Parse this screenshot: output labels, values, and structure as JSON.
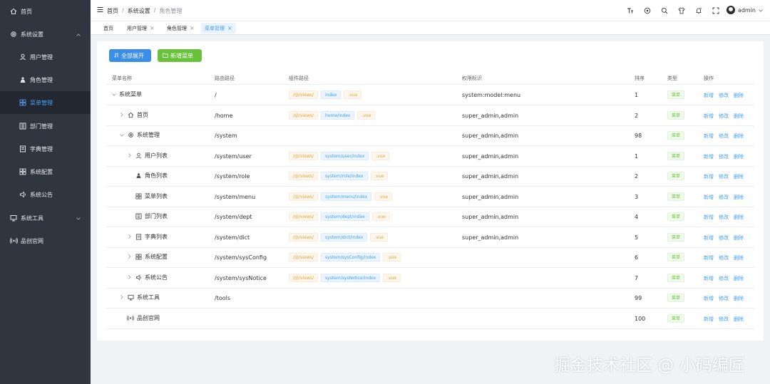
{
  "sidebar": {
    "items": [
      {
        "label": "首页",
        "icon": "home-icon"
      },
      {
        "label": "系统设置",
        "icon": "gear-icon"
      },
      {
        "label": "用户管理",
        "icon": "user-icon"
      },
      {
        "label": "角色管理",
        "icon": "role-icon"
      },
      {
        "label": "菜单管理",
        "icon": "menu-icon"
      },
      {
        "label": "部门管理",
        "icon": "dept-icon"
      },
      {
        "label": "字典管理",
        "icon": "dict-icon"
      },
      {
        "label": "系统配置",
        "icon": "config-icon"
      },
      {
        "label": "系统公告",
        "icon": "notice-icon"
      },
      {
        "label": "系统工具",
        "icon": "monitor-icon"
      },
      {
        "label": "品创官网",
        "icon": "broadcast-icon"
      }
    ]
  },
  "breadcrumb": {
    "home": "首页",
    "section": "系统设置",
    "current": "角色管理",
    "sep": "/"
  },
  "user": {
    "name": "admin"
  },
  "tabs": [
    {
      "label": "首页",
      "closable": false
    },
    {
      "label": "用户管理",
      "closable": true
    },
    {
      "label": "角色管理",
      "closable": true
    },
    {
      "label": "菜单管理",
      "closable": true
    }
  ],
  "toolbar": {
    "expand_label": "全部展开",
    "add_label": "新增菜单"
  },
  "table": {
    "headers": {
      "name": "菜单名称",
      "route": "路由路径",
      "component": "组件路径",
      "perm": "权限标识",
      "sort": "排序",
      "type": "类型",
      "ops": "操作"
    },
    "ops": {
      "add": "新增",
      "edit": "修改",
      "del": "删除"
    },
    "type_label": "菜单",
    "rows": [
      {
        "name": "系统菜单",
        "route": "/",
        "comp": [
          "/@/views/",
          "index",
          ".vue"
        ],
        "perm": "system:model:menu",
        "sort": "1"
      },
      {
        "name": "首页",
        "route": "/home",
        "comp": [
          "/@/views/",
          "home/index",
          ".vue"
        ],
        "perm": "super_admin,admin",
        "sort": "2"
      },
      {
        "name": "系统管理",
        "route": "/system",
        "comp": [],
        "perm": "super_admin,admin",
        "sort": "98"
      },
      {
        "name": "用户列表",
        "route": "/system/user",
        "comp": [
          "/@/views/",
          "system/user/index",
          ".vue"
        ],
        "perm": "super_admin,admin",
        "sort": "1"
      },
      {
        "name": "角色列表",
        "route": "/system/role",
        "comp": [
          "/@/views/",
          "system/role/index",
          ".vue"
        ],
        "perm": "super_admin,admin",
        "sort": "2"
      },
      {
        "name": "菜单列表",
        "route": "/system/menu",
        "comp": [
          "/@/views/",
          "system/menu/index",
          ".vue"
        ],
        "perm": "super_admin,admin",
        "sort": "3"
      },
      {
        "name": "部门列表",
        "route": "/system/dept",
        "comp": [
          "/@/views/",
          "system/dept/index",
          ".vue"
        ],
        "perm": "super_admin,admin",
        "sort": "4"
      },
      {
        "name": "字典列表",
        "route": "/system/dict",
        "comp": [
          "/@/views/",
          "system/dict/index",
          ".vue"
        ],
        "perm": "super_admin,admin",
        "sort": "5"
      },
      {
        "name": "系统配置",
        "route": "/system/sysConfig",
        "comp": [
          "/@/views/",
          "system/sysConfig/index",
          ".vue"
        ],
        "perm": "",
        "sort": "6"
      },
      {
        "name": "系统公告",
        "route": "/system/sysNotice",
        "comp": [
          "/@/views/",
          "system/sysNotice/index",
          ".vue"
        ],
        "perm": "",
        "sort": "7"
      },
      {
        "name": "系统工具",
        "route": "/tools",
        "comp": [],
        "perm": "",
        "sort": "99"
      },
      {
        "name": "品创官网",
        "route": "",
        "comp": [],
        "perm": "",
        "sort": "100"
      }
    ]
  },
  "watermark": "掘金技术社区 @ 小码编匠"
}
